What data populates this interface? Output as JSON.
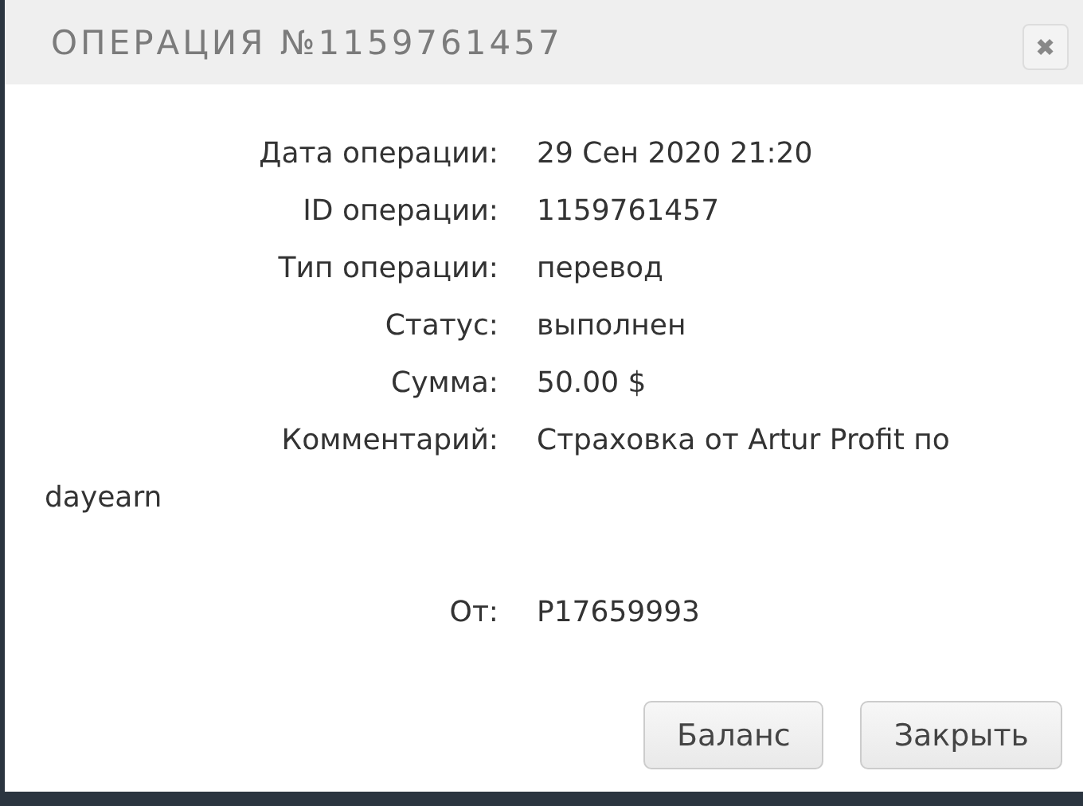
{
  "dialog": {
    "title": "ОПЕРАЦИЯ №1159761457",
    "close": "✖"
  },
  "fields": [
    {
      "label": "Дата операции:",
      "value": "29 Сен 2020 21:20"
    },
    {
      "label": "ID операции:",
      "value": "1159761457"
    },
    {
      "label": "Тип операции:",
      "value": "перевод"
    },
    {
      "label": "Статус:",
      "value": "выполнен"
    },
    {
      "label": "Сумма:",
      "value": "50.00 $"
    },
    {
      "label": "Комментарий:",
      "value": "Страховка от Artur Profit по",
      "continued": "dayearn"
    }
  ],
  "from": {
    "label": "От:",
    "value": "P17659993"
  },
  "buttons": [
    "Баланс",
    "Закрыть"
  ]
}
